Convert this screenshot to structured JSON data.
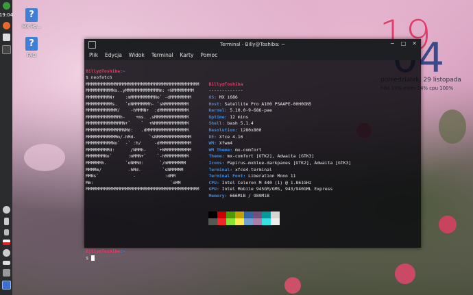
{
  "desktop": {
    "icons": [
      {
        "label": "MX Po..."
      },
      {
        "label": "FAQ"
      }
    ],
    "clock_widget": {
      "hour": "19",
      "minute": "04",
      "date": "poniedziałek, 29 listopada",
      "stats": "hdd 19% mem 14% cpu 100%"
    }
  },
  "panel": {
    "time": "19:04"
  },
  "window": {
    "title": "Terminal - Billy@Toshiba: ~",
    "menu": [
      "Plik",
      "Edycja",
      "Widok",
      "Terminal",
      "Karty",
      "Pomoc"
    ]
  },
  "terminal": {
    "prompt_user": "Billy@Toshiba",
    "prompt_path": ":~",
    "command": "$ neofetch",
    "logo": [
      "MMMMMMMMMMMMMMMMMMMMMMMMMMMMMMMMMMMMMMMMMMM",
      "MMMMMMMMMMNs..yMMMMMMMMMMMMMm: +NMMMMMMMM",
      "MMMMMMMMMN+    :mMMMMMMMMMNo` -dMMMMMMMM",
      "MMMMMMMMMMs.   `oNMMMMMMh- `sNMMMMMMMMM",
      "MMMMMMMMMMMM/    -hMMMN+  :dMMMMMMMMMMM",
      "MMMMMMMMMMMMMh-    +ms. .sMMMMMMMMMMMMM",
      "MMMMMMMMMMMMMMN+`    `  +NMMMMMMMMMMMMM",
      "MMMMMMMMMMMMMMNMd:   .dMMMMMMMMMMMMMMMM",
      "MMMMMMMMMMMMm/-hMd-     `sNMMMMMMMMMMMMM",
      "MMMMMMMMMMNo`  -` :h/     -dMMMMMMMMMMMM",
      "MMMMMMMMMd:      /NMMh-    `+NMMMMMMMMMM",
      "MMMMMMMNo`      :mMMN+`    `-hMMMMMMMMM",
      "MMMMMMh.       `oNMMd:      `/mMMMMMMM",
      "MMMMm/          -hMd-        `sNMMMMM",
      "MMNs`             -           :dMM",
      "Mm:                             `oMM",
      "MMMMMMMMMMMMMMMMMMMMMMMMMMMMMMMMMMMMMMMMMMM"
    ],
    "info_user": "Billy@Toshiba",
    "info_sep": "-------------",
    "info": [
      {
        "key": "OS",
        "value": "MX i686"
      },
      {
        "key": "Host",
        "value": "Satellite Pro A100 PSAAPE-00H0GN5"
      },
      {
        "key": "Kernel",
        "value": "5.10.0-9-686-pae"
      },
      {
        "key": "Uptime",
        "value": "12 mins"
      },
      {
        "key": "Shell",
        "value": "bash 5.1.4"
      },
      {
        "key": "Resolution",
        "value": "1280x800"
      },
      {
        "key": "DE",
        "value": "Xfce 4.16"
      },
      {
        "key": "WM",
        "value": "Xfwm4"
      },
      {
        "key": "WM Theme",
        "value": "mx-comfort"
      },
      {
        "key": "Theme",
        "value": "mx-comfort [GTK2], Adwaita [GTK3]"
      },
      {
        "key": "Icons",
        "value": "Papirus-mxblue-darkpanes [GTK2], Adwaita [GTK3]"
      },
      {
        "key": "Terminal",
        "value": "xfce4-terminal"
      },
      {
        "key": "Terminal Font",
        "value": "Liberation Mono 11"
      },
      {
        "key": "CPU",
        "value": "Intel Celeron M 440 (1) @ 1.861GHz"
      },
      {
        "key": "GPU",
        "value": "Intel Mobile 945GM/GMS, 943/940GML Express"
      },
      {
        "key": "Memory",
        "value": "666MiB / 989MiB"
      }
    ],
    "palette_top": [
      "#000000",
      "#cc0000",
      "#4e9a06",
      "#c4a000",
      "#3465a4",
      "#75507b",
      "#06989a",
      "#d3d7cf"
    ],
    "palette_bottom": [
      "#555753",
      "#ef2929",
      "#8ae234",
      "#fce94f",
      "#739fcf",
      "#ad7fa8",
      "#34e2e2",
      "#eeeeec"
    ],
    "final_prompt": "$"
  }
}
